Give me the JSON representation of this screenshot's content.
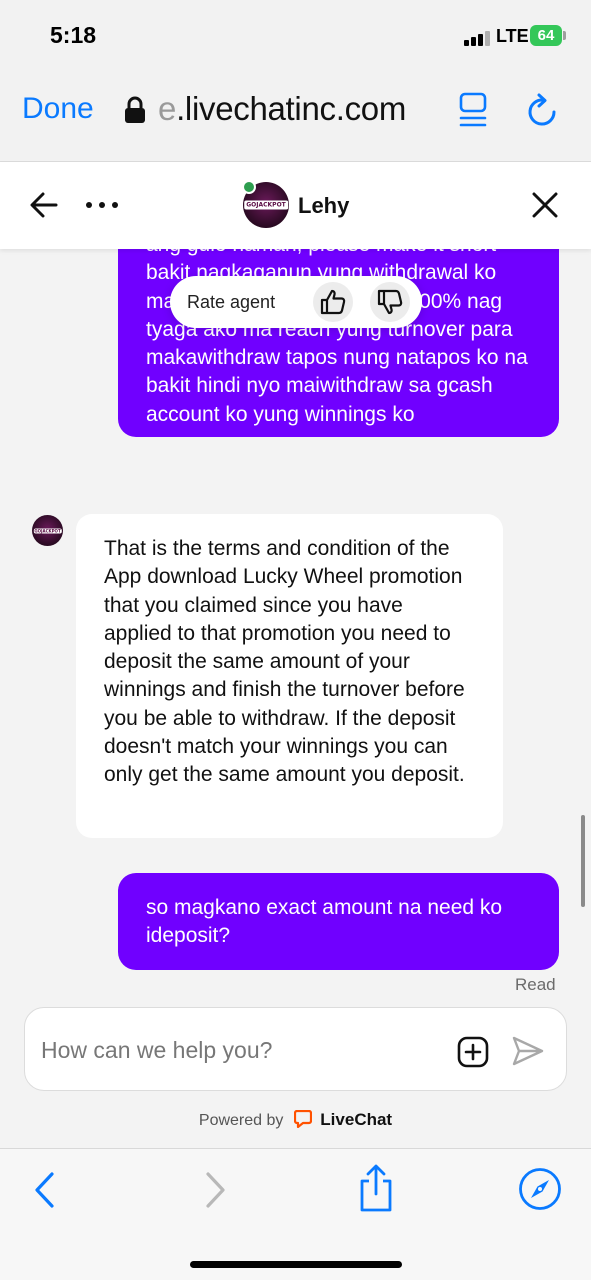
{
  "status_bar": {
    "time": "5:18",
    "network": "LTE",
    "battery": "64"
  },
  "browser": {
    "done_label": "Done",
    "url_prefix": "e",
    "url_rest": ".livechatinc.com"
  },
  "chat_header": {
    "agent_name": "Lehy",
    "avatar_text": "GOJACKPOT"
  },
  "messages": {
    "user_1": "ang gulo naman, please make it short bakit nagkaganun yung withdrawal ko may first deposit bonus nyo 100% nag tyaga ako ma reach yung turnover para makawithdraw tapos nung natapos ko na bakit hindi nyo maiwithdraw sa gcash account ko yung winnings ko",
    "agent_1": "That is the terms and condition of the App download Lucky Wheel promotion that you claimed since you have applied to that promotion you need to deposit the same amount of your winnings and finish the turnover before you be able to withdraw. If the deposit doesn't match your winnings you can only get the same amount you deposit.",
    "user_2": "so magkano exact amount na need ko ideposit?",
    "read_status": "Read"
  },
  "rate_agent": {
    "label": "Rate agent"
  },
  "composer": {
    "placeholder": "How can we help you?"
  },
  "footer": {
    "powered_by": "Powered by",
    "brand": "LiveChat"
  },
  "colors": {
    "accent": "#7000ff",
    "ios_blue": "#0a7aff",
    "online": "#2e9e4f",
    "battery": "#34c759",
    "livechat_orange": "#ff5100"
  }
}
